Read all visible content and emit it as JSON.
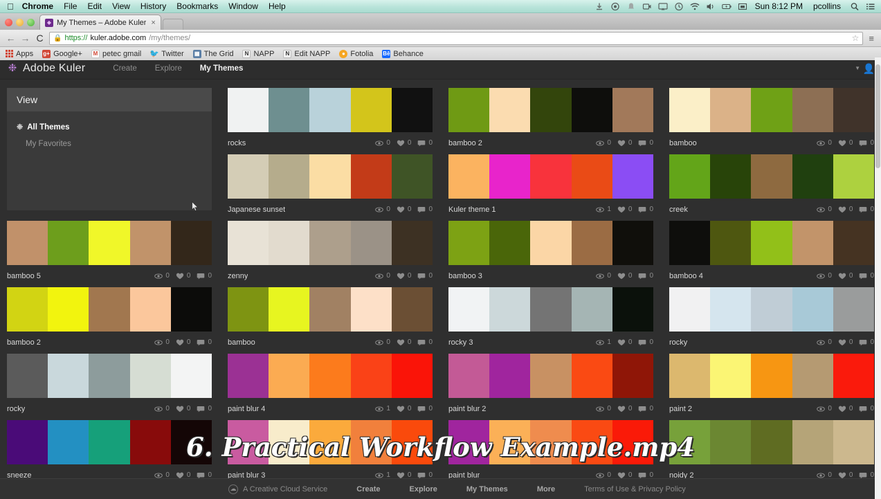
{
  "os_menubar": {
    "apple_icon": "apple-icon",
    "items": [
      "Chrome",
      "File",
      "Edit",
      "View",
      "History",
      "Bookmarks",
      "Window",
      "Help"
    ],
    "status_icons": [
      "dropbox-icon",
      "crashplan-icon",
      "bell-icon",
      "screen-record-icon",
      "airplay-icon",
      "time-machine-icon",
      "wifi-icon",
      "volume-icon",
      "battery-icon",
      "input-source-icon"
    ],
    "clock": "Sun 8:12 PM",
    "user": "pcollins",
    "search_icon": "spotlight-search-icon",
    "notification_icon": "notification-center-icon"
  },
  "browser": {
    "tab": {
      "title": "My Themes – Adobe Kuler",
      "favicon": "kuler-favicon",
      "close_icon": "close-icon"
    },
    "new_tab_label": "",
    "back_icon": "back-arrow-icon",
    "forward_icon": "forward-arrow-icon",
    "reload_icon": "C",
    "omnibox": {
      "lock_icon": "lock-icon",
      "scheme": "https://",
      "host": "kuler.adobe.com",
      "path": "/my/themes/",
      "star_icon": "bookmark-star-icon"
    },
    "menu_icon": "chrome-menu-icon",
    "bookmarks": [
      {
        "label": "Apps",
        "icon": "apps-grid-icon",
        "color": "#d14836"
      },
      {
        "label": "Google+",
        "icon": "google-plus-icon",
        "color": "#d14836"
      },
      {
        "label": "petec gmail",
        "icon": "gmail-icon",
        "color": "#ffffff"
      },
      {
        "label": "Twitter",
        "icon": "twitter-icon",
        "color": "#55acee"
      },
      {
        "label": "The Grid",
        "icon": "the-grid-icon",
        "color": "#5b7fa6"
      },
      {
        "label": "NAPP",
        "icon": "napp-icon",
        "color": "#f2f2f2"
      },
      {
        "label": "Edit NAPP",
        "icon": "napp-icon",
        "color": "#f2f2f2"
      },
      {
        "label": "Fotolia",
        "icon": "fotolia-icon",
        "color": "#f5a623"
      },
      {
        "label": "Behance",
        "icon": "behance-icon",
        "color": "#1769ff"
      }
    ]
  },
  "kuler": {
    "brand": "Adobe Kuler",
    "logo_icon": "kuler-logo-icon",
    "nav": [
      {
        "label": "Create",
        "active": false
      },
      {
        "label": "Explore",
        "active": false
      },
      {
        "label": "My Themes",
        "active": true
      }
    ],
    "account": {
      "caret_icon": "chevron-down-icon",
      "avatar_icon": "user-avatar-icon"
    },
    "view_panel": {
      "title": "View",
      "items": [
        {
          "label": "All Themes",
          "selected": true,
          "icon": "kuler-mark-icon"
        },
        {
          "label": "My Favorites",
          "selected": false
        }
      ]
    },
    "stat_icons": {
      "views": "eye-icon",
      "likes": "heart-icon",
      "comments": "comment-icon"
    },
    "footer": {
      "service_icon": "creative-cloud-icon",
      "service_label": "A Creative Cloud Service",
      "links": [
        "Create",
        "Explore",
        "My Themes",
        "More"
      ],
      "terms": "Terms of Use  &  Privacy Policy"
    },
    "themes": [
      {
        "name": "rocks",
        "views": "0",
        "likes": "0",
        "comments": "0",
        "colors": [
          "#f0f2f2",
          "#6e8f90",
          "#b9d2da",
          "#d3c51b",
          "#111111"
        ]
      },
      {
        "name": "bamboo 2",
        "views": "0",
        "likes": "0",
        "comments": "0",
        "colors": [
          "#6f9a14",
          "#fbdcb0",
          "#33450c",
          "#0e0e0c",
          "#a2795a"
        ]
      },
      {
        "name": "bamboo",
        "views": "0",
        "likes": "0",
        "comments": "0",
        "colors": [
          "#fbefc8",
          "#dbb288",
          "#6fa116",
          "#8d6f54",
          "#40332a"
        ]
      },
      {
        "name": "Japanese sunset",
        "views": "0",
        "likes": "0",
        "comments": "0",
        "colors": [
          "#d4cdb6",
          "#b5ac8c",
          "#fbdda4",
          "#c33b18",
          "#3f5426"
        ]
      },
      {
        "name": "Kuler theme 1",
        "views": "1",
        "likes": "0",
        "comments": "0",
        "colors": [
          "#fbb360",
          "#e824cb",
          "#f8333c",
          "#ea4b16",
          "#8b4df4"
        ]
      },
      {
        "name": "creek",
        "views": "0",
        "likes": "0",
        "comments": "0",
        "colors": [
          "#63a519",
          "#284409",
          "#8e6a40",
          "#20400f",
          "#add13f"
        ]
      },
      {
        "name": "bamboo 5",
        "views": "0",
        "likes": "0",
        "comments": "0",
        "colors": [
          "#c1916a",
          "#6d9e1c",
          "#f0f729",
          "#c1936a",
          "#33271a"
        ]
      },
      {
        "name": "zenny",
        "views": "0",
        "likes": "0",
        "comments": "0",
        "colors": [
          "#e8e2d6",
          "#e2dbce",
          "#ad9f8c",
          "#9b9287",
          "#3d3123"
        ]
      },
      {
        "name": "bamboo 3",
        "views": "0",
        "likes": "0",
        "comments": "0",
        "colors": [
          "#7da214",
          "#4a6609",
          "#fbd6a6",
          "#9b6c44",
          "#100f0b"
        ]
      },
      {
        "name": "bamboo 4",
        "views": "0",
        "likes": "0",
        "comments": "0",
        "colors": [
          "#0e0e0c",
          "#4e5710",
          "#92c019",
          "#c2946a",
          "#453322"
        ]
      },
      {
        "name": "bamboo 2",
        "views": "0",
        "likes": "0",
        "comments": "0",
        "colors": [
          "#d2d413",
          "#f2f40e",
          "#a1774f",
          "#fbc79c",
          "#0c0c0a"
        ]
      },
      {
        "name": "bamboo",
        "views": "0",
        "likes": "0",
        "comments": "0",
        "colors": [
          "#7e9412",
          "#e7f520",
          "#a18163",
          "#fde0c8",
          "#6b4f34"
        ]
      },
      {
        "name": "rocky 3",
        "views": "1",
        "likes": "0",
        "comments": "0",
        "colors": [
          "#f1f3f4",
          "#ccd8da",
          "#747474",
          "#a5b5b4",
          "#0b110b"
        ]
      },
      {
        "name": "rocky",
        "views": "0",
        "likes": "0",
        "comments": "0",
        "colors": [
          "#f1f1f2",
          "#d5e5ee",
          "#c0cdd6",
          "#a8c9d7",
          "#9a9c9c"
        ]
      },
      {
        "name": "rocky",
        "views": "0",
        "likes": "0",
        "comments": "0",
        "colors": [
          "#5b5b5b",
          "#c9d8dc",
          "#8d9c9c",
          "#d6ddd3",
          "#f3f4f4"
        ]
      },
      {
        "name": "paint blur 4",
        "views": "1",
        "likes": "0",
        "comments": "0",
        "colors": [
          "#9b3194",
          "#fbab52",
          "#fc7b1c",
          "#fa4217",
          "#fa1408"
        ]
      },
      {
        "name": "paint blur 2",
        "views": "0",
        "likes": "0",
        "comments": "0",
        "colors": [
          "#c35a96",
          "#a0259e",
          "#c89163",
          "#fa4a13",
          "#8f1607"
        ]
      },
      {
        "name": "paint 2",
        "views": "0",
        "likes": "0",
        "comments": "0",
        "colors": [
          "#dcb86e",
          "#fbf574",
          "#f79612",
          "#b59a72",
          "#fa1a0c"
        ]
      },
      {
        "name": "sneeze",
        "views": "0",
        "likes": "0",
        "comments": "0",
        "colors": [
          "#4a0b78",
          "#2390c2",
          "#16a07a",
          "#880b0b",
          "#140606"
        ]
      },
      {
        "name": "paint blur 3",
        "views": "1",
        "likes": "0",
        "comments": "0",
        "colors": [
          "#c95ba0",
          "#f8eccb",
          "#fbaa3c",
          "#f1803c",
          "#fa4a0c"
        ]
      },
      {
        "name": "paint blur",
        "views": "0",
        "likes": "0",
        "comments": "0",
        "colors": [
          "#a0259e",
          "#fbb057",
          "#ef8c4e",
          "#fa4a13",
          "#fa1a08"
        ]
      },
      {
        "name": "noidy 2",
        "views": "0",
        "likes": "0",
        "comments": "0",
        "colors": [
          "#77a13a",
          "#6b8732",
          "#5f6c22",
          "#b5a478",
          "#ccb88e"
        ]
      }
    ]
  },
  "video_overlay": {
    "title": "6. Practical Workflow Example.mp4"
  }
}
